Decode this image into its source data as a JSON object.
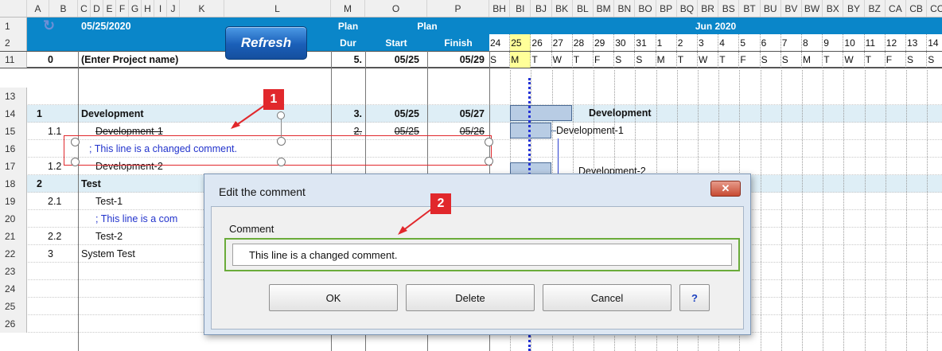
{
  "column_headers": [
    "A",
    "B",
    "C",
    "D",
    "E",
    "F",
    "G",
    "H",
    "I",
    "J",
    "K",
    "L",
    "M",
    "O",
    "P",
    "BH",
    "BI",
    "BJ",
    "BK",
    "BL",
    "BM",
    "BN",
    "BO",
    "BP",
    "BQ",
    "BR",
    "BS",
    "BT",
    "BU",
    "BV",
    "BW",
    "BX",
    "BY",
    "BZ",
    "CA",
    "CB",
    "CC"
  ],
  "header": {
    "date": "05/25/2020",
    "refresh_label": "Refresh",
    "plan_label": "Plan",
    "dur_label": "Dur",
    "plan_group_label": "Plan",
    "start_label": "Start",
    "finish_label": "Finish",
    "month_label": "Jun 2020"
  },
  "row_numbers": [
    "1",
    "2",
    "11",
    "13",
    "14",
    "15",
    "16",
    "17",
    "18",
    "19",
    "20",
    "21",
    "22",
    "23",
    "24",
    "25",
    "26"
  ],
  "dates": [
    "24",
    "25",
    "26",
    "27",
    "28",
    "29",
    "30",
    "31",
    "1",
    "2",
    "3",
    "4",
    "5",
    "6",
    "7",
    "8",
    "9",
    "10",
    "11",
    "12",
    "13",
    "14"
  ],
  "weekdays": [
    "S",
    "M",
    "T",
    "W",
    "T",
    "F",
    "S",
    "S",
    "M",
    "T",
    "W",
    "T",
    "F",
    "S",
    "S",
    "M",
    "T",
    "W",
    "T",
    "F",
    "S",
    "S"
  ],
  "tasks": [
    {
      "id": "0",
      "name": "(Enter Project name)",
      "dur": "5.",
      "start": "05/25",
      "finish": "05/29"
    },
    {
      "id": "1",
      "name": "Development",
      "dur": "3.",
      "start": "05/25",
      "finish": "05/27"
    },
    {
      "id": "1.1",
      "name": "Development-1",
      "dur": "2.",
      "start": "05/25",
      "finish": "05/26"
    },
    {
      "id": "",
      "name": "; This line is a changed comment."
    },
    {
      "id": "1.2",
      "name": "Development-2"
    },
    {
      "id": "2",
      "name": "Test"
    },
    {
      "id": "2.1",
      "name": "Test-1"
    },
    {
      "id": "",
      "name": "; This line is a com"
    },
    {
      "id": "2.2",
      "name": "Test-2"
    },
    {
      "id": "3",
      "name": "System Test"
    }
  ],
  "gantt_labels": {
    "development": "Development",
    "development_1": "Development-1",
    "development_2": "Development-2"
  },
  "callouts": [
    "1",
    "2"
  ],
  "dialog": {
    "title": "Edit the comment",
    "close_label": "✕",
    "comment_label": "Comment",
    "comment_value": "This line is a changed comment.",
    "ok_label": "OK",
    "delete_label": "Delete",
    "cancel_label": "Cancel",
    "help_label": "?"
  },
  "colors": {
    "header_blue": "#0a86c9",
    "section_band": "#deeef6",
    "today_highlight": "#ffff99",
    "gantt_bar": "#b8cce4",
    "today_line": "#2433d6",
    "callout": "#e1282c",
    "comment_text": "#2233cc",
    "dialog_frame": "#dde7f3"
  }
}
